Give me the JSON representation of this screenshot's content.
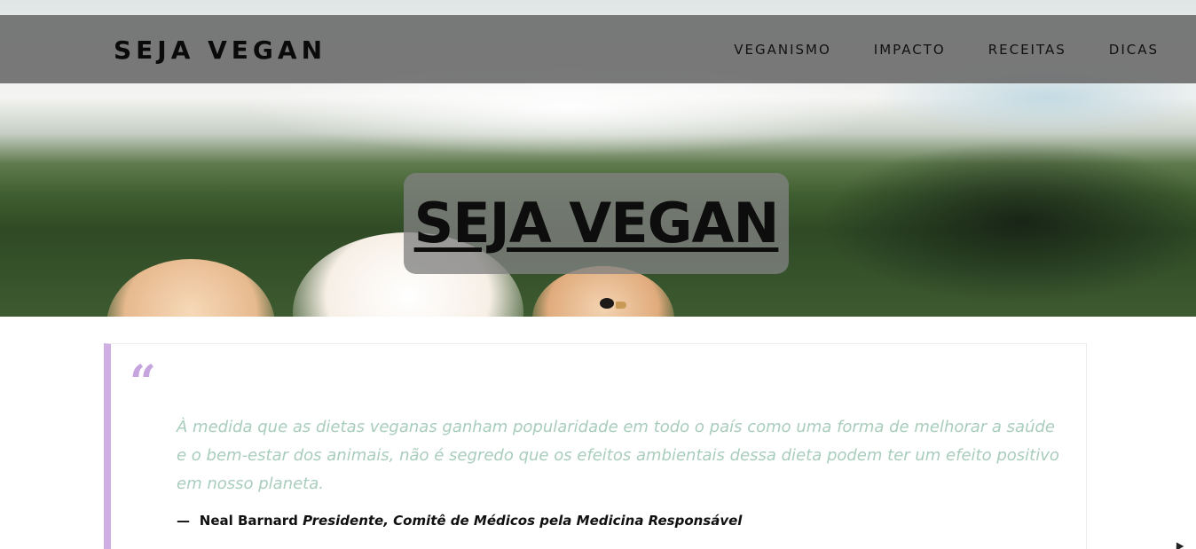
{
  "navbar": {
    "brand": "SEJA VEGAN",
    "links": [
      {
        "label": "VEGANISMO"
      },
      {
        "label": "IMPACTO"
      },
      {
        "label": "RECEITAS"
      },
      {
        "label": "DICAS"
      }
    ]
  },
  "hero": {
    "title": "SEJA VEGAN"
  },
  "quote": {
    "mark": "“",
    "text": "À medida que as dietas veganas ganham popularidade em todo o país como uma forma de melhorar a saúde e o bem-estar dos animais, não é segredo que os efeitos ambientais dessa dieta podem ter um efeito positivo em nosso planeta.",
    "dash": "—",
    "author": "Neal Barnard",
    "role": "Presidente, Comitê de Médicos pela Medicina Responsável"
  },
  "colors": {
    "navbar_bg": "#6e6e6e",
    "quote_border": "#cfaee3",
    "quote_text": "#a9cdbd"
  }
}
